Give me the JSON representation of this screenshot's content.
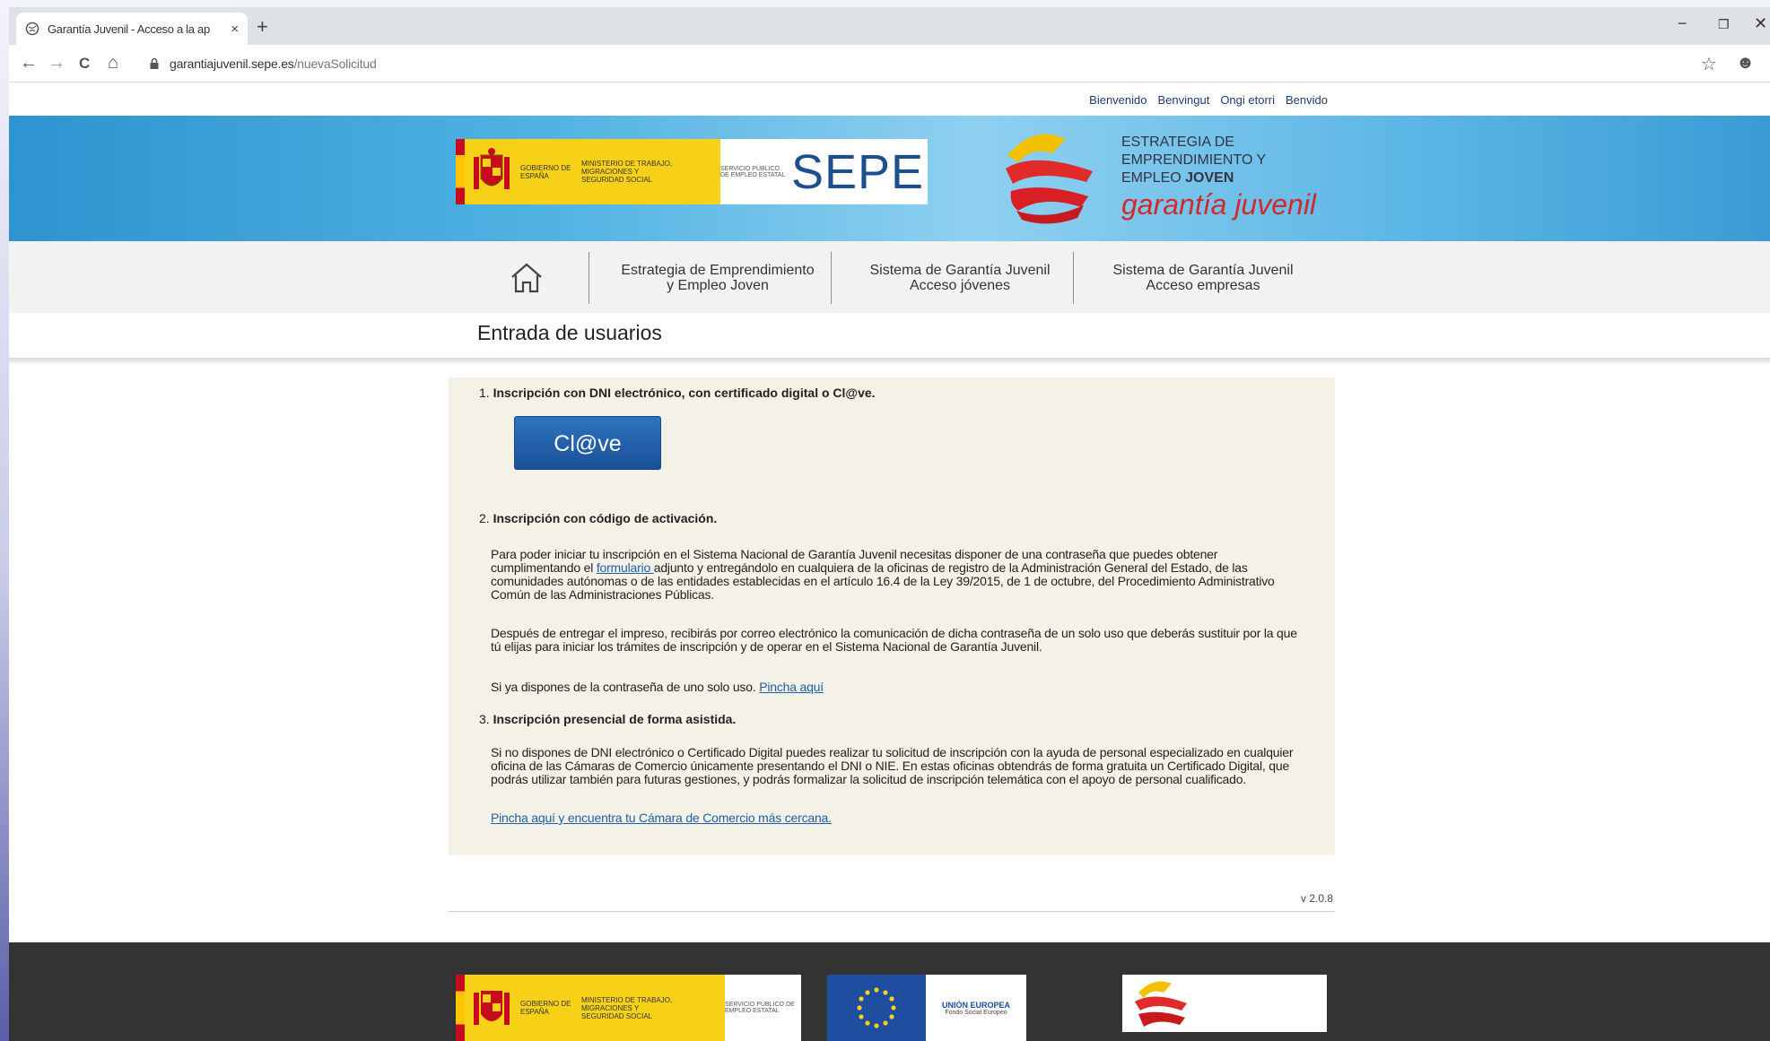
{
  "browser": {
    "tab_title": "Garantía Juvenil - Acceso a la ap",
    "tab_close": "×",
    "newtab": "+",
    "url_domain": "garantiajuvenil.sepe.es",
    "url_path": "/nuevaSolicitud",
    "nav": {
      "back": "←",
      "forward": "→",
      "reload": "C",
      "home": "⌂"
    },
    "window_controls": {
      "minimize": "−",
      "restore": "❐",
      "close": "✕"
    },
    "star": "☆",
    "profile": "☻",
    "menu": "⋮"
  },
  "lang_links": [
    "Bienvenido",
    "Benvingut",
    "Ongi etorri",
    "Benvido"
  ],
  "banner": {
    "gov_label": "GOBIERNO DE ESPAÑA",
    "ministry_label": "MINISTERIO DE TRABAJO, MIGRACIONES Y SEGURIDAD SOCIAL",
    "servicio_label": "SERVICIO PÚBLICO DE EMPLEO ESTATAL",
    "sepe": "SEPE",
    "gj_line1": "ESTRATEGIA DE",
    "gj_line2": "EMPRENDIMIENTO Y",
    "gj_line3a": "EMPLEO ",
    "gj_line3b": "JOVEN",
    "gj_name": "garantía juvenil"
  },
  "nav": {
    "item1_line1": "Estrategia de Emprendimiento",
    "item1_line2": "y Empleo Joven",
    "item2_line1": "Sistema de Garantía Juvenil",
    "item2_line2": "Acceso jóvenes",
    "item3_line1": "Sistema de Garantía Juvenil",
    "item3_line2": "Acceso empresas"
  },
  "section_title": "Entrada de usuarios",
  "panel": {
    "h1_num": "1.",
    "h1": " Inscripción con DNI electrónico, con certificado digital o Cl@ve.",
    "clave_button": "Cl@ve",
    "h2_num": "2.",
    "h2": " Inscripción con código de activación.",
    "p1_before": "Para poder iniciar tu inscripción en el Sistema Nacional de Garantía Juvenil necesitas disponer de una contraseña que puedes obtener cumplimentando el ",
    "p1_link": "formulario ",
    "p1_after": "adjunto y entregándolo en cualquiera de la oficinas de registro de la Administración General del Estado, de las comunidades autónomas o de las entidades establecidas en el artículo 16.4 de la Ley 39/2015, de 1 de octubre, del Procedimiento Administrativo Común de las Administraciones Públicas.",
    "p2": "Después de entregar el impreso, recibirás por correo electrónico la comunicación de dicha contraseña de un solo uso que deberás sustituir por la que tú elijas para iniciar los trámites de inscripción y de operar en el Sistema Nacional de Garantía Juvenil.",
    "p3_before": "Si ya dispones de la contraseña de uno solo uso. ",
    "p3_link": "Pincha aquí",
    "h3_num": "3.",
    "h3": " Inscripción presencial de forma asistida.",
    "p4": "Si no dispones de DNI electrónico o Certificado Digital puedes realizar tu solicitud de inscripción con la ayuda de personal especializado en cualquier oficina de las Cámaras de Comercio únicamente presentando el DNI o NIE. En estas oficinas obtendrás de forma gratuita un Certificado Digital, que podrás utilizar también para futuras gestiones, y podrás formalizar la solicitud de inscripción telemática con el apoyo de personal cualificado.",
    "p5_link": "Pincha aquí y encuentra tu Cámara de Comercio más cercana."
  },
  "version": "v 2.0.8",
  "footer": {
    "eu_label": "UNIÓN EUROPEA",
    "eu_sub": "Fondo Social Europeo"
  },
  "colors": {
    "banner": "#4fb2e2",
    "panel_bg": "#f4f2e6",
    "button": "#1a5097",
    "link": "#1f5fa8",
    "footer": "#333333"
  }
}
